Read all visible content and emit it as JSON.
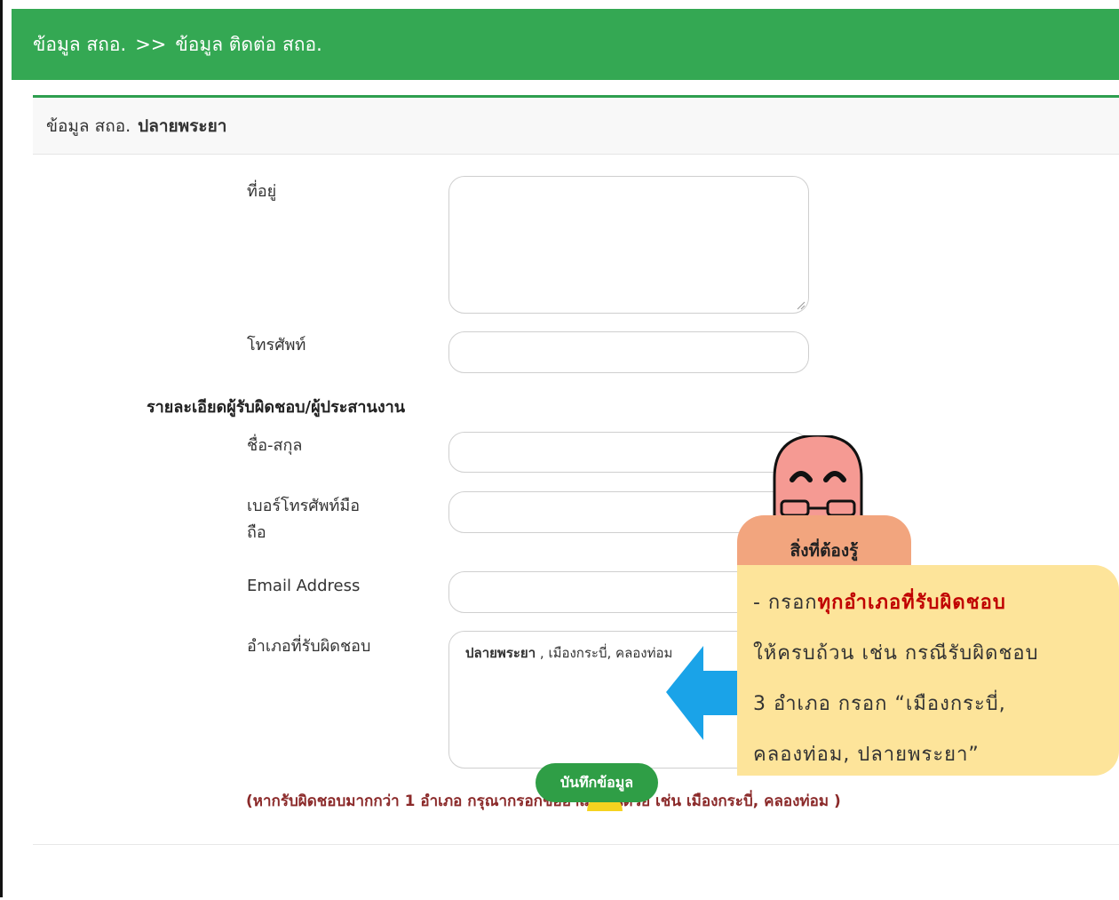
{
  "breadcrumb": {
    "root": "ข้อมูล สถอ.",
    "separator": ">>",
    "current": "ข้อมูล ติดต่อ สถอ."
  },
  "card": {
    "title_prefix": "ข้อมูล สถอ.",
    "title_name": "ปลายพระยา"
  },
  "form": {
    "address_label": "ที่อยู่",
    "phone_label": "โทรศัพท์",
    "section_title": "รายละเอียดผู้รับผิดชอบ/ผู้ประสานงาน",
    "name_label": "ชื่อ-สกุล",
    "mobile_label_line1": "เบอร์โทรศัพท์มือ",
    "mobile_label_line2": "ถือ",
    "email_label": "Email Address",
    "district_label": "อำเภอที่รับผิดชอบ",
    "district_value_bold": "ปลายพระยา",
    "district_value_rest": " , เมืองกระบี่, คลองท่อม",
    "note": "(หากรับผิดชอบมากกว่า 1 อำเภอ กรุณากรอกชื่ออำเภออื่นด้วย เช่น เมืองกระบี่, คลองท่อม )",
    "save_label": "บันทึกข้อมูล"
  },
  "overlay": {
    "heading": "สิ่งที่ต้องรู้",
    "line1_prefix": "- กรอก",
    "line1_highlight": "ทุกอำเภอที่รับผิดชอบ",
    "line2": "ให้ครบถ้วน เช่น กรณีรับผิดชอบ",
    "line3": "3 อำเภอ กรอก “เมืองกระบี่,",
    "line4": "คลองท่อม, ปลายพระยา”"
  },
  "colors": {
    "header_green": "#34a853",
    "button_green": "#2f9e46",
    "note_red": "#8b2a2a",
    "tip_yellow": "#fde49a",
    "arrow_blue": "#1aa3e8"
  }
}
